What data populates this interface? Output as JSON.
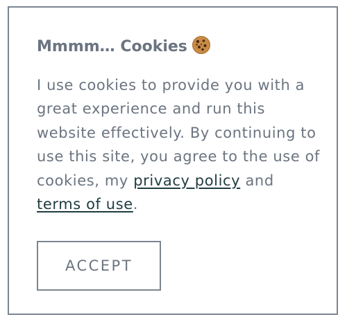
{
  "cookie_banner": {
    "title": "Mmmm… Cookies",
    "title_icon": "cookie-icon",
    "message_prefix": "I use cookies to provide you with a great experience and run this website effectively. By continuing to use this site, you agree to the use of cookies, my",
    "privacy_link_label": "privacy policy",
    "conjunction": "and",
    "terms_link_label": "terms of use",
    "message_suffix": ".",
    "accept_label": "ACCEPT"
  },
  "colors": {
    "text": "#6b7480",
    "link": "#1f3b41",
    "border": "#7a8590",
    "background": "#ffffff"
  }
}
